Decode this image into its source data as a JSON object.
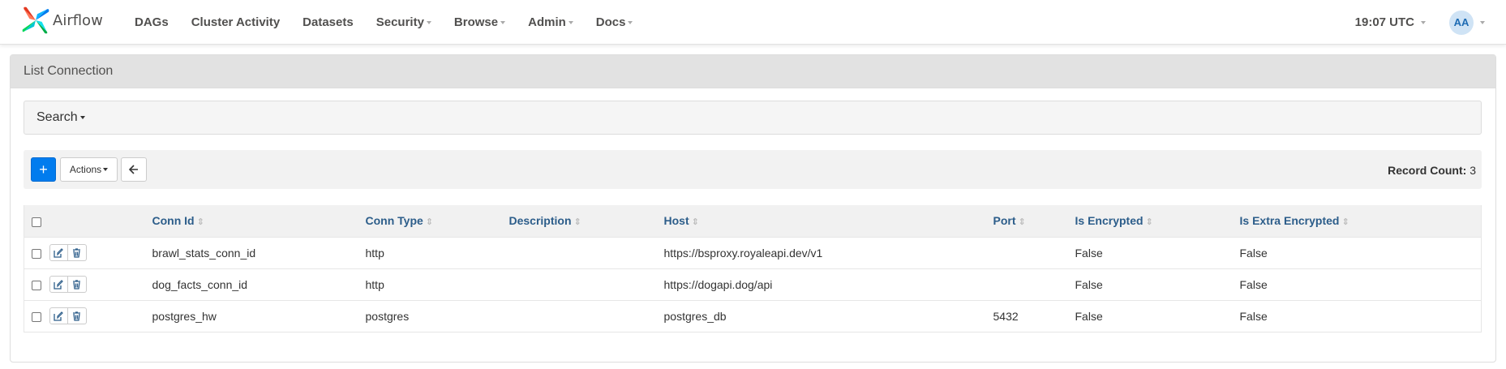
{
  "app": {
    "name": "Airflow"
  },
  "nav": {
    "items": [
      {
        "label": "DAGs",
        "dropdown": false
      },
      {
        "label": "Cluster Activity",
        "dropdown": false
      },
      {
        "label": "Datasets",
        "dropdown": false
      },
      {
        "label": "Security",
        "dropdown": true
      },
      {
        "label": "Browse",
        "dropdown": true
      },
      {
        "label": "Admin",
        "dropdown": true
      },
      {
        "label": "Docs",
        "dropdown": true
      }
    ],
    "clock": "19:07 UTC",
    "user_initials": "AA"
  },
  "panel": {
    "title": "List Connection"
  },
  "search": {
    "label": "Search"
  },
  "toolbar": {
    "add_label": "+",
    "actions_label": "Actions",
    "record_count_label": "Record Count:",
    "record_count": "3"
  },
  "table": {
    "columns": [
      "Conn Id",
      "Conn Type",
      "Description",
      "Host",
      "Port",
      "Is Encrypted",
      "Is Extra Encrypted"
    ],
    "rows": [
      {
        "conn_id": "brawl_stats_conn_id",
        "conn_type": "http",
        "description": "",
        "host": "https://bsproxy.royaleapi.dev/v1",
        "port": "",
        "is_encrypted": "False",
        "is_extra_encrypted": "False"
      },
      {
        "conn_id": "dog_facts_conn_id",
        "conn_type": "http",
        "description": "",
        "host": "https://dogapi.dog/api",
        "port": "",
        "is_encrypted": "False",
        "is_extra_encrypted": "False"
      },
      {
        "conn_id": "postgres_hw",
        "conn_type": "postgres",
        "description": "",
        "host": "postgres_db",
        "port": "5432",
        "is_encrypted": "False",
        "is_extra_encrypted": "False"
      }
    ]
  },
  "colors": {
    "brand_blue": "#017cee",
    "header_link": "#2c5d8a",
    "panel_heading": "#e2e2e2"
  },
  "icons": {
    "logo": "airflow-pinwheel-icon",
    "edit": "edit-icon",
    "delete": "trash-icon",
    "back": "arrow-left-icon",
    "sort": "sort-icon"
  }
}
